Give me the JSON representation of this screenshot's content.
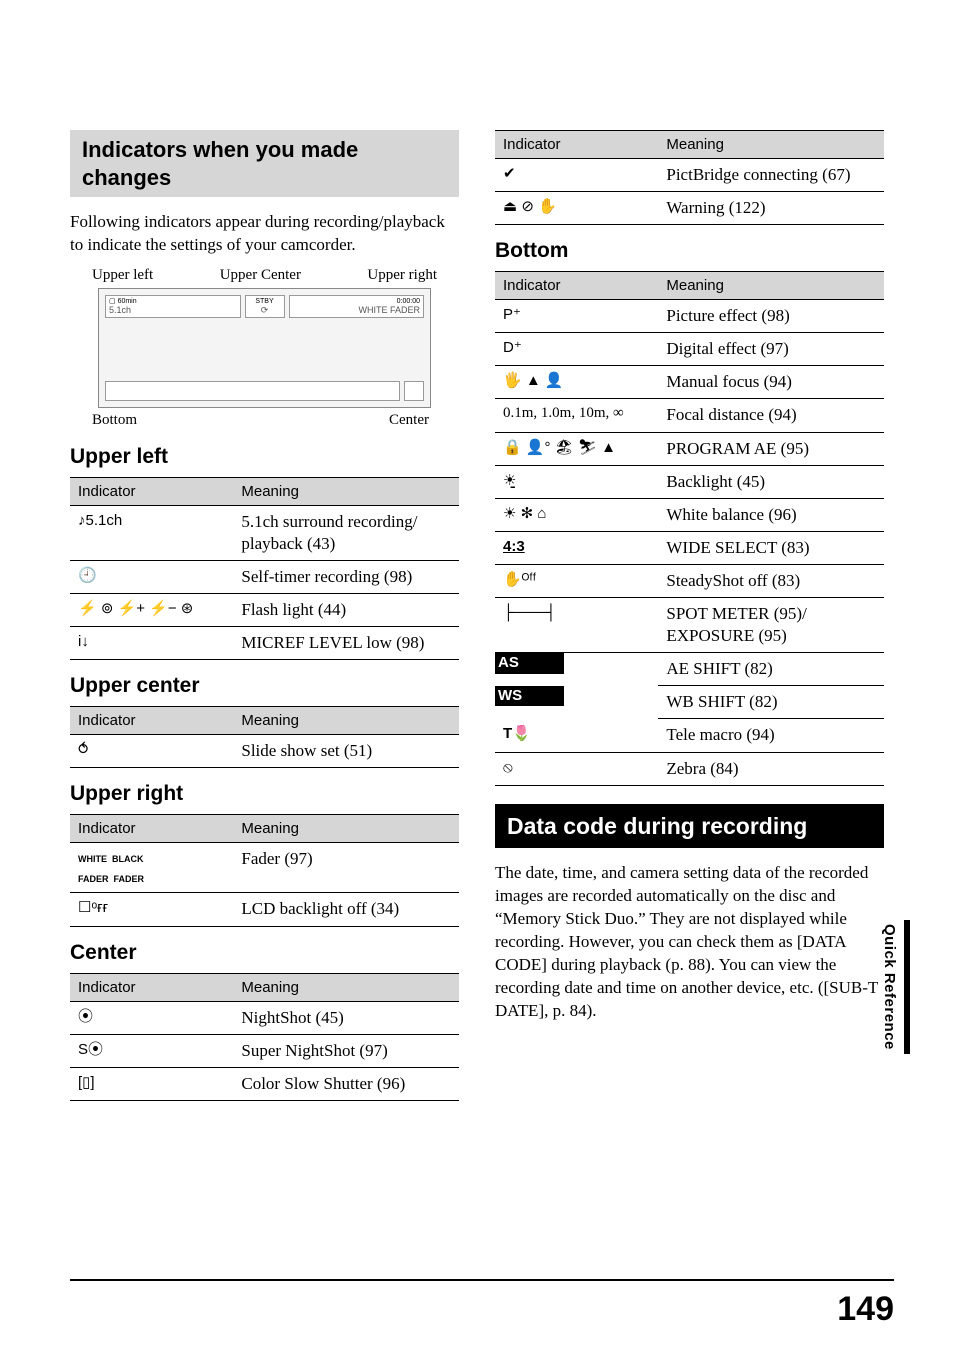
{
  "page_number": "149",
  "side_tab": "Quick Reference",
  "left": {
    "section_title": "Indicators when you made changes",
    "intro": "Following indicators appear during recording/playback to indicate the settings of your camcorder.",
    "diagram": {
      "top_left": "Upper left",
      "top_center": "Upper Center",
      "top_right": "Upper right",
      "bottom_left": "Bottom",
      "bottom_right": "Center",
      "readouts": {
        "battery": "60min",
        "stby": "STBY",
        "tc": "0:00:00",
        "wf": "WHITE FADER",
        "ch": "5.1ch"
      }
    },
    "upper_left": {
      "heading": "Upper left",
      "th_indicator": "Indicator",
      "th_meaning": "Meaning",
      "rows": [
        {
          "ind": "♪5.1ch",
          "mean": "5.1ch surround recording/ playback (43)"
        },
        {
          "ind": "🕘",
          "mean": "Self-timer recording (98)"
        },
        {
          "ind": "⚡ ⊚ ⚡+ ⚡−  ⊛",
          "mean": "Flash light (44)"
        },
        {
          "ind": "i↓",
          "mean": "MICREF LEVEL low (98)"
        }
      ]
    },
    "upper_center": {
      "heading": "Upper center",
      "th_indicator": "Indicator",
      "th_meaning": "Meaning",
      "rows": [
        {
          "ind": "⥀",
          "mean": "Slide show set (51)"
        }
      ]
    },
    "upper_right": {
      "heading": "Upper right",
      "th_indicator": "Indicator",
      "th_meaning": "Meaning",
      "rows": [
        {
          "ind_html": "WHITE  BLACK\nFADER  FADER",
          "mean": "Fader (97)"
        },
        {
          "ind": "☐ᵒғғ",
          "mean": "LCD backlight off (34)"
        }
      ]
    },
    "center": {
      "heading": "Center",
      "th_indicator": "Indicator",
      "th_meaning": "Meaning",
      "rows": [
        {
          "ind": "⦿",
          "mean": "NightShot (45)"
        },
        {
          "ind": "S⦿",
          "mean": "Super NightShot (97)"
        },
        {
          "ind": "[▯]",
          "mean": "Color Slow Shutter (96)"
        }
      ]
    }
  },
  "right": {
    "top_table": {
      "th_indicator": "Indicator",
      "th_meaning": "Meaning",
      "rows": [
        {
          "ind": "✔",
          "mean": "PictBridge connecting (67)"
        },
        {
          "ind": "⏏ ⊘ ✋",
          "mean": "Warning (122)"
        }
      ]
    },
    "bottom": {
      "heading": "Bottom",
      "th_indicator": "Indicator",
      "th_meaning": "Meaning",
      "rows": [
        {
          "ind": "P⁺",
          "mean": "Picture effect (98)"
        },
        {
          "ind": "D⁺",
          "mean": "Digital effect (97)"
        },
        {
          "ind": "🖐 ▲ 👤",
          "mean": "Manual focus (94)"
        },
        {
          "ind": "0.1m, 1.0m, 10m, ∞",
          "mean": "Focal distance (94)"
        },
        {
          "ind": "🔒 👤°  🏖 ⛷ ▲",
          "mean": "PROGRAM AE (95)"
        },
        {
          "ind": "☀̱",
          "mean": "Backlight (45)"
        },
        {
          "ind": "☀ ✻ ⌂",
          "mean": "White balance (96)"
        },
        {
          "ind": "4:3",
          "mean": "WIDE SELECT (83)"
        },
        {
          "ind": "✋ᴼᶠᶠ",
          "mean": "SteadyShot off (83)"
        },
        {
          "ind": "├───┤",
          "mean": "SPOT METER (95)/ EXPOSURE (95)"
        },
        {
          "ind": "AS",
          "mean": "AE SHIFT (82)"
        },
        {
          "ind": "WS",
          "mean": "WB SHIFT (82)"
        },
        {
          "ind": "T🌷",
          "mean": "Tele macro (94)"
        },
        {
          "ind": "⦸",
          "mean": "Zebra (84)"
        }
      ]
    },
    "data_code": {
      "heading": "Data code during recording",
      "body": "The date, time, and camera setting data of the recorded images are recorded automatically on the disc and “Memory Stick Duo.” They are not displayed while recording. However, you can check them as [DATA CODE] during playback (p. 88). You can view the recording date and time on another device, etc. ([SUB-T DATE], p. 84)."
    }
  }
}
